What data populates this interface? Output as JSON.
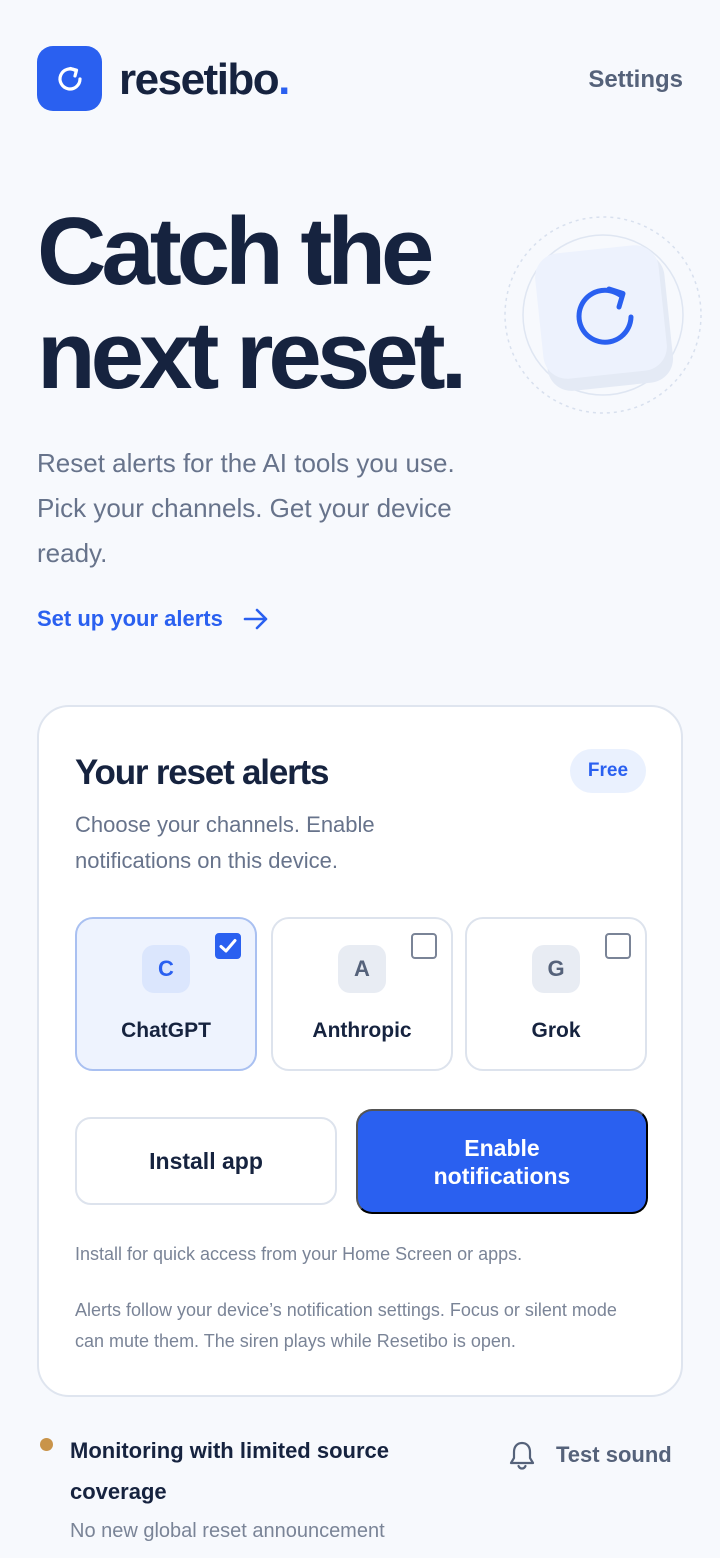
{
  "header": {
    "brand_name": "resetibo",
    "brand_dot": ".",
    "settings_label": "Settings"
  },
  "hero": {
    "title": "Catch the next reset.",
    "subtitle": "Reset alerts for the AI tools you use. Pick your channels. Get your device ready.",
    "cta_label": "Set up your alerts"
  },
  "alerts_card": {
    "title": "Your reset alerts",
    "badge": "Free",
    "subtitle": "Choose your channels. Enable notifications on this device.",
    "channels": [
      {
        "initial": "C",
        "name": "ChatGPT",
        "checked": true
      },
      {
        "initial": "A",
        "name": "Anthropic",
        "checked": false
      },
      {
        "initial": "G",
        "name": "Grok",
        "checked": false
      }
    ],
    "install_label": "Install app",
    "enable_label": "Enable notifications",
    "install_note": "Install for quick access from your Home Screen or apps.",
    "alerts_note": "Alerts follow your device’s notification settings. Focus or silent mode can mute them. The siren plays while Resetibo is open."
  },
  "status": {
    "title": "Monitoring with limited source coverage",
    "text": "No new global reset announcement",
    "test_sound_label": "Test sound"
  },
  "colors": {
    "accent": "#2a60f0",
    "ink": "#16233f",
    "muted": "#67738b",
    "status_dot": "#c9944a"
  },
  "icons": {
    "logo": "refresh-icon",
    "cta": "arrow-right-icon",
    "check": "check-icon",
    "test_sound": "bell-icon"
  }
}
